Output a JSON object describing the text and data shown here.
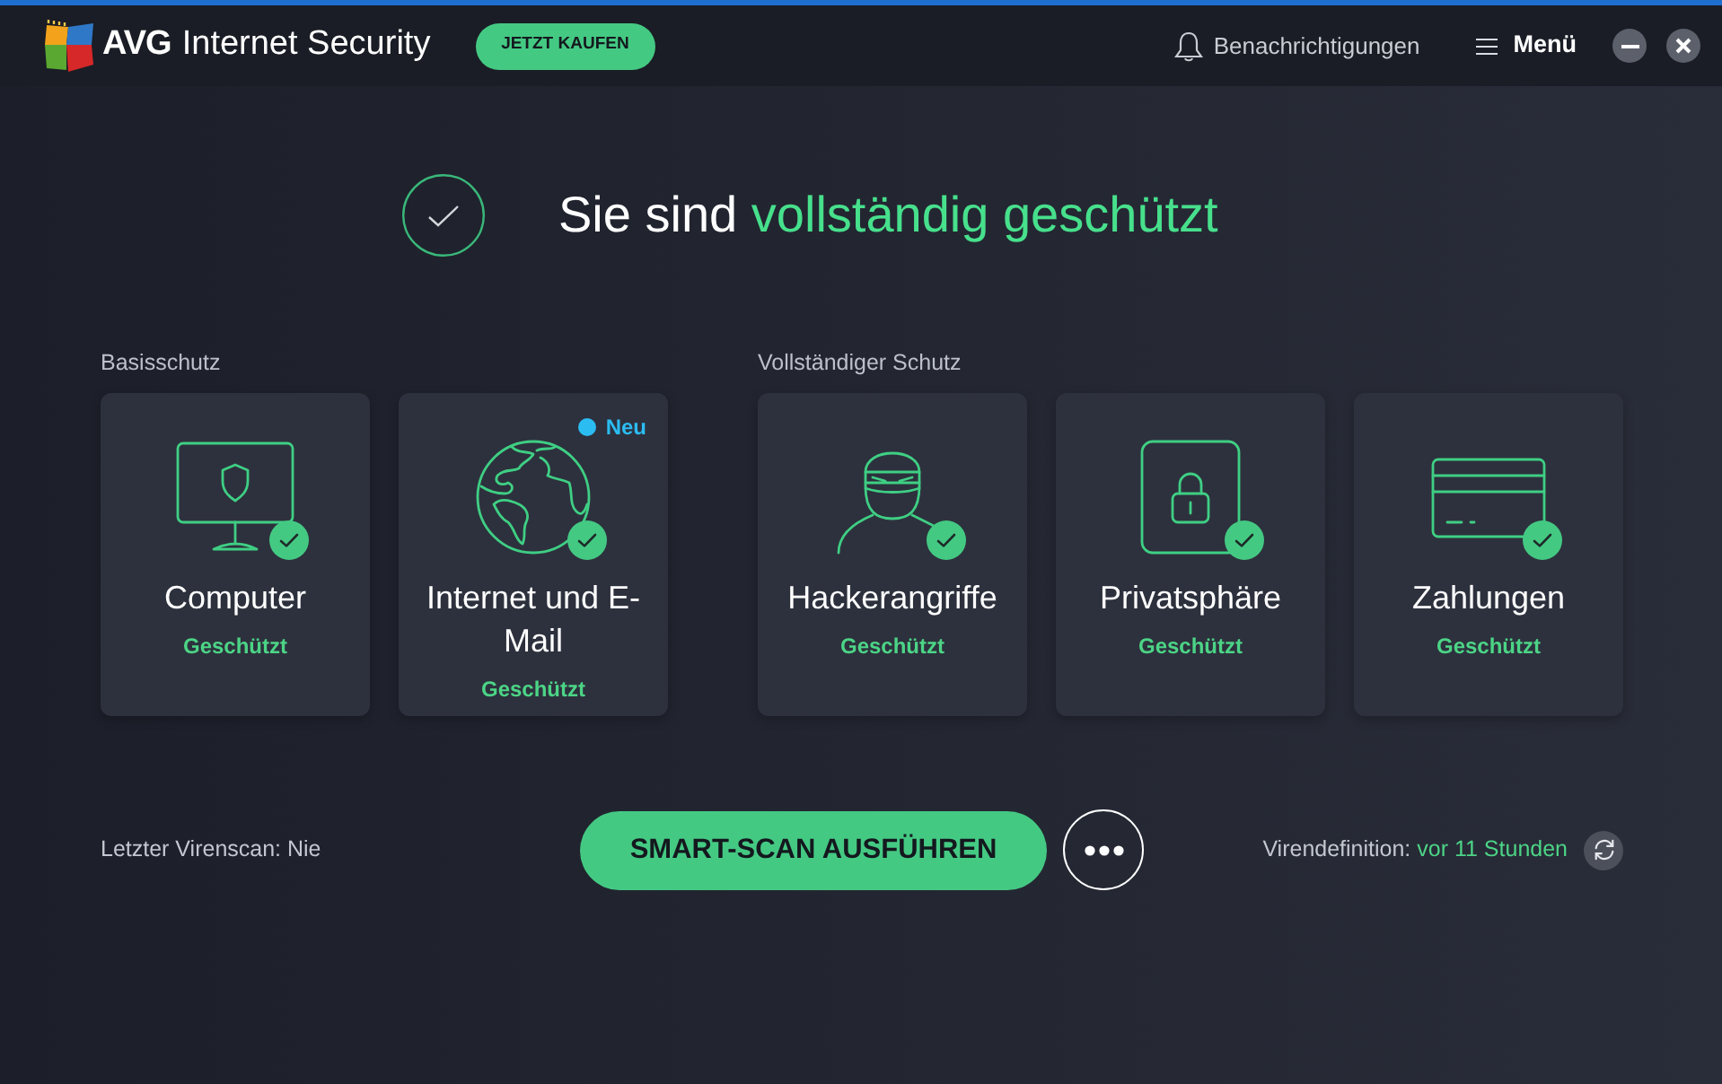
{
  "header": {
    "brand": "AVG",
    "product": "Internet Security",
    "buy_button": "JETZT KAUFEN",
    "notifications": "Benachrichtigungen",
    "menu": "Menü"
  },
  "status": {
    "text": "Sie sind",
    "highlight": "vollständig geschützt"
  },
  "sections": [
    {
      "label": "Basisschutz",
      "cards": [
        {
          "kind": "computer",
          "title": "Computer",
          "status": "Geschützt",
          "protected": true
        },
        {
          "kind": "globe",
          "title": "Internet und E-Mail",
          "status": "Geschützt",
          "protected": true,
          "badge": "Neu"
        }
      ]
    },
    {
      "label": "Vollständiger Schutz",
      "cards": [
        {
          "kind": "hacker",
          "title": "Hackerangriffe",
          "status": "Geschützt",
          "protected": true
        },
        {
          "kind": "lock",
          "title": "Privatsphäre",
          "status": "Geschützt",
          "protected": true
        },
        {
          "kind": "payment",
          "title": "Zahlungen",
          "status": "Geschützt",
          "protected": true
        }
      ]
    }
  ],
  "footer": {
    "last_scan": "Letzter Virenscan: Nie",
    "scan_button": "SMART-SCAN AUSFÜHREN",
    "definitions_label": "Virendefinition:",
    "definitions_age": "vor 11 Stunden"
  }
}
